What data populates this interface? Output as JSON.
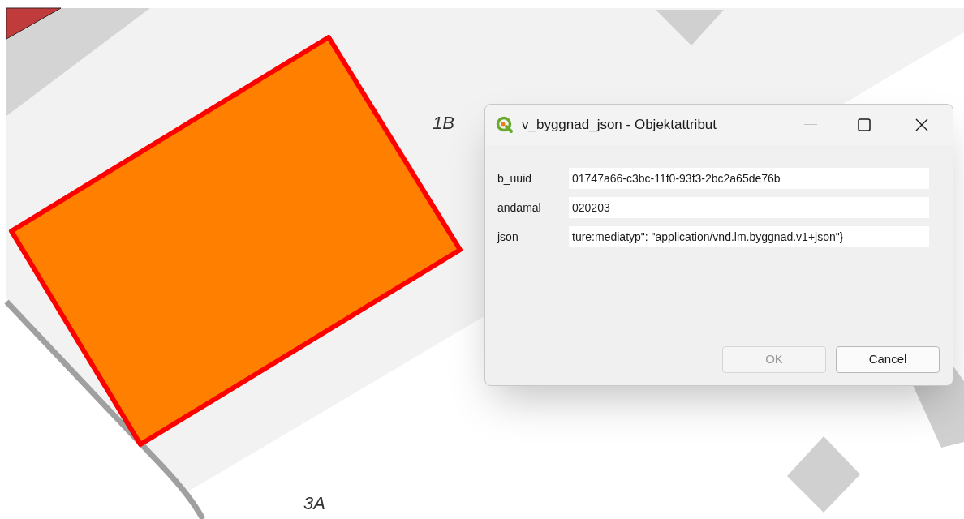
{
  "map": {
    "labels": [
      {
        "text": "1B"
      },
      {
        "text": "3A"
      }
    ]
  },
  "dialog": {
    "title": "v_byggnad_json - Objektattribut",
    "fields": [
      {
        "label": "b_uuid",
        "value": "01747a66-c3bc-11f0-93f3-2bc2a65de76b"
      },
      {
        "label": "andamal",
        "value": "020203"
      },
      {
        "label": "json",
        "value": "ture:mediatyp\": \"application/vnd.lm.byggnad.v1+json\"}"
      }
    ],
    "buttons": [
      {
        "label": "OK",
        "disabled": true
      },
      {
        "label": "Cancel",
        "disabled": false
      }
    ]
  }
}
